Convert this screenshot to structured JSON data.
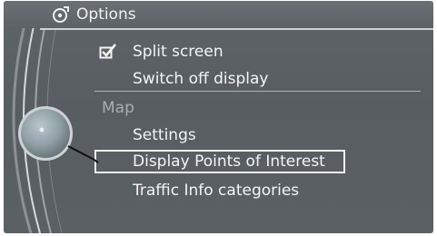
{
  "header": {
    "title": "Options"
  },
  "menu": {
    "split_screen": "Split screen",
    "switch_off_display": "Switch off display",
    "section_map": "Map",
    "settings": "Settings",
    "display_poi": "Display Points of Interest",
    "traffic_info": "Traffic Info categories"
  },
  "state": {
    "split_screen_checked": true,
    "selected_item": "Display Points of Interest"
  }
}
